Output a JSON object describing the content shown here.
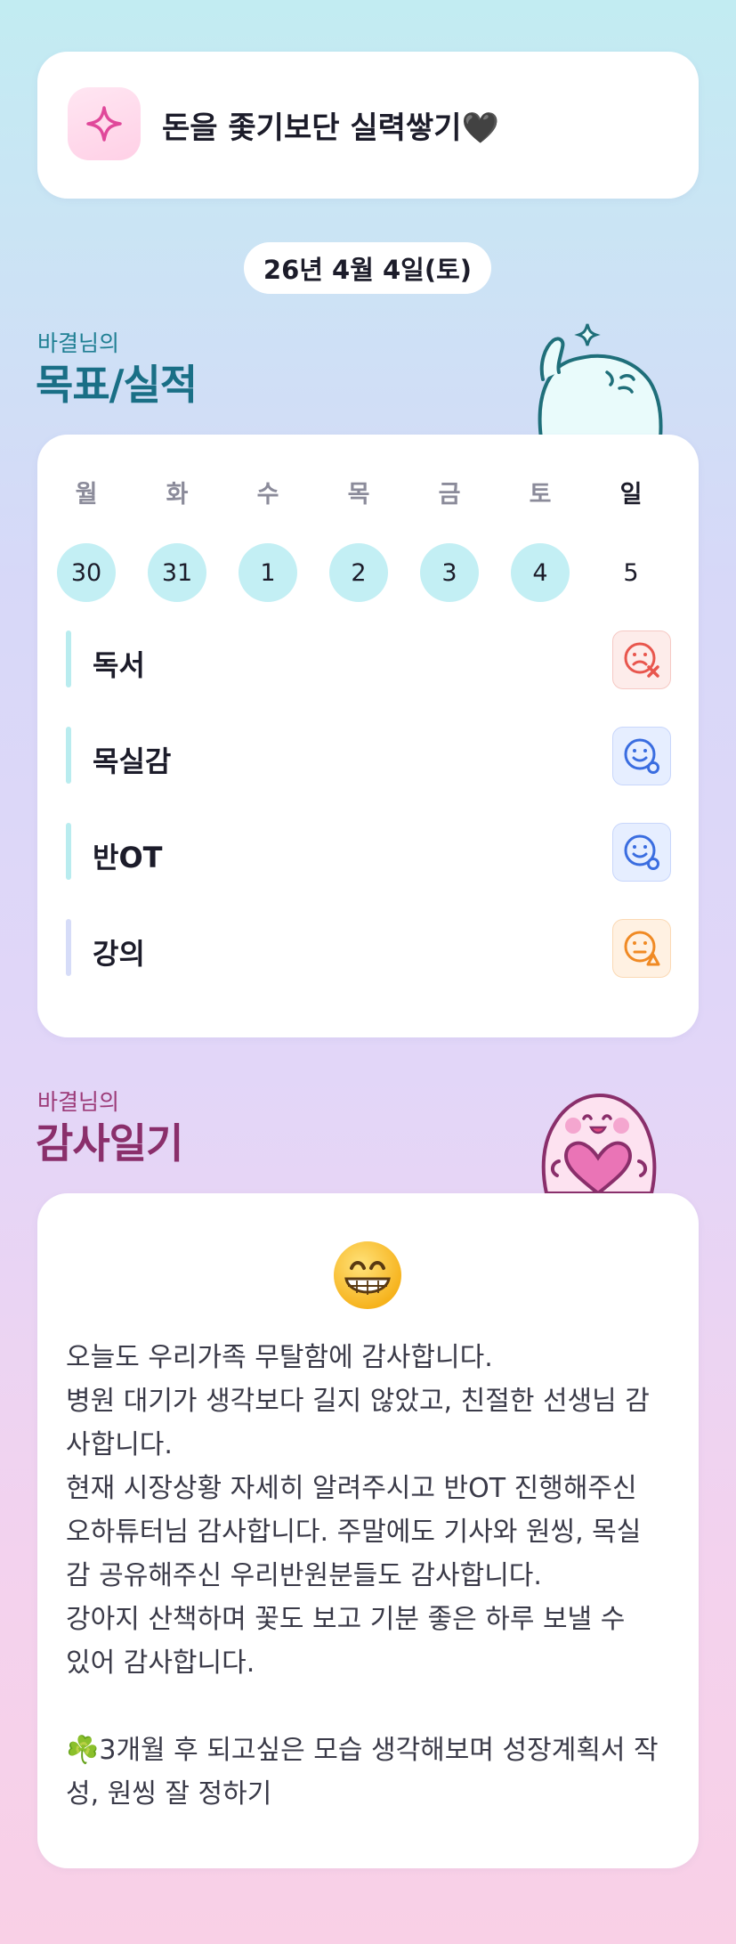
{
  "motto": {
    "text": "돈을 좇기보단 실력쌓기🖤",
    "icon": "sparkle-icon"
  },
  "date": "26년 4월 4일(토)",
  "goals_section": {
    "subtitle": "바결님의",
    "title": "목표/실적"
  },
  "week": {
    "days": [
      {
        "label": "월",
        "num": "30",
        "done": true
      },
      {
        "label": "화",
        "num": "31",
        "done": true
      },
      {
        "label": "수",
        "num": "1",
        "done": true
      },
      {
        "label": "목",
        "num": "2",
        "done": true
      },
      {
        "label": "금",
        "num": "3",
        "done": true
      },
      {
        "label": "토",
        "num": "4",
        "done": true
      },
      {
        "label": "일",
        "num": "5",
        "done": false
      }
    ]
  },
  "goals": [
    {
      "name": "독서",
      "status": "fail",
      "bar_color": "#b9ecef",
      "status_color": "#e8564d",
      "status_bg": "#fdecea"
    },
    {
      "name": "목실감",
      "status": "done",
      "bar_color": "#b9ecef",
      "status_color": "#3a6de0",
      "status_bg": "#e6eeff"
    },
    {
      "name": "반OT",
      "status": "done",
      "bar_color": "#b9ecef",
      "status_color": "#3a6de0",
      "status_bg": "#e6eeff"
    },
    {
      "name": "강의",
      "status": "partial",
      "bar_color": "#d6dcf8",
      "status_color": "#f08a24",
      "status_bg": "#fff1e2"
    }
  ],
  "diary_section": {
    "subtitle": "바결님의",
    "title": "감사일기"
  },
  "diary": {
    "mood_icon": "grinning-face-icon",
    "text": "오늘도 우리가족 무탈함에 감사합니다.\n병원 대기가 생각보다 길지 않았고, 친절한 선생님 감\n사합니다.\n현재 시장상황 자세히 알려주시고 반OT 진행해주신\n오하튜터님 감사합니다. 주말에도 기사와 원씽, 목실\n감 공유해주신 우리반원분들도 감사합니다.\n강아지 산책하며 꽃도 보고 기분 좋은 하루 보낼 수\n있어 감사합니다.\n\n☘️3개월 후 되고싶은 모습 생각해보며 성장계획서 작\n성, 원씽 잘 정하기"
  }
}
